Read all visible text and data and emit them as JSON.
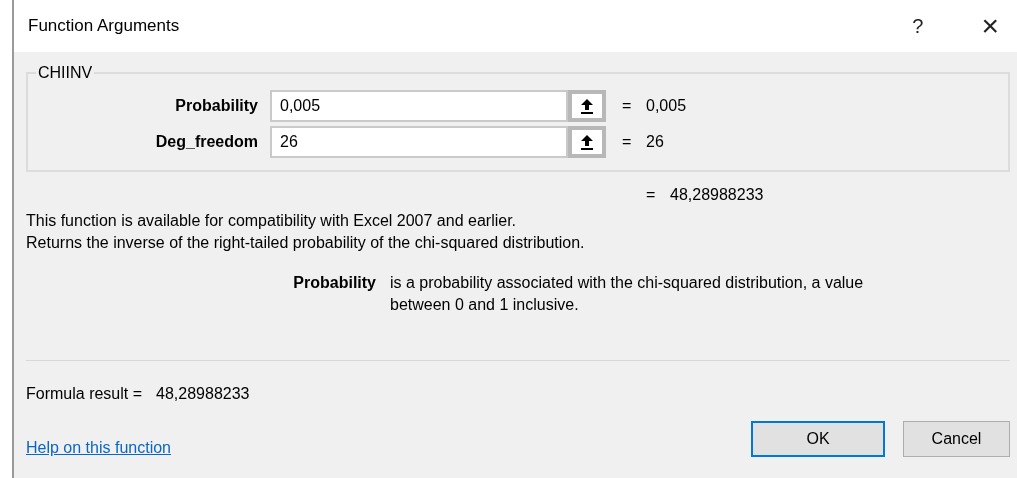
{
  "window": {
    "title": "Function Arguments",
    "help": "?",
    "close": "×"
  },
  "function_name": "CHIINV",
  "arguments": [
    {
      "label": "Probability",
      "value": "0,005",
      "result": "0,005",
      "result_prefix": "="
    },
    {
      "label": "Deg_freedom",
      "value": "26",
      "result": "26",
      "result_prefix": "="
    }
  ],
  "function_result": {
    "prefix": "=",
    "value": "48,28988233"
  },
  "description": [
    "This function is available for compatibility with Excel 2007 and earlier.",
    "Returns the inverse of the right-tailed probability of the chi-squared distribution."
  ],
  "argument_help": {
    "name": "Probability",
    "text": "is a probability associated with the chi-squared distribution, a value between 0 and 1 inclusive."
  },
  "formula_result": {
    "label": "Formula result =",
    "value": "48,28988233"
  },
  "help_link": "Help on this function",
  "buttons": [
    {
      "label": "OK",
      "default": true
    },
    {
      "label": "Cancel",
      "default": false
    }
  ]
}
